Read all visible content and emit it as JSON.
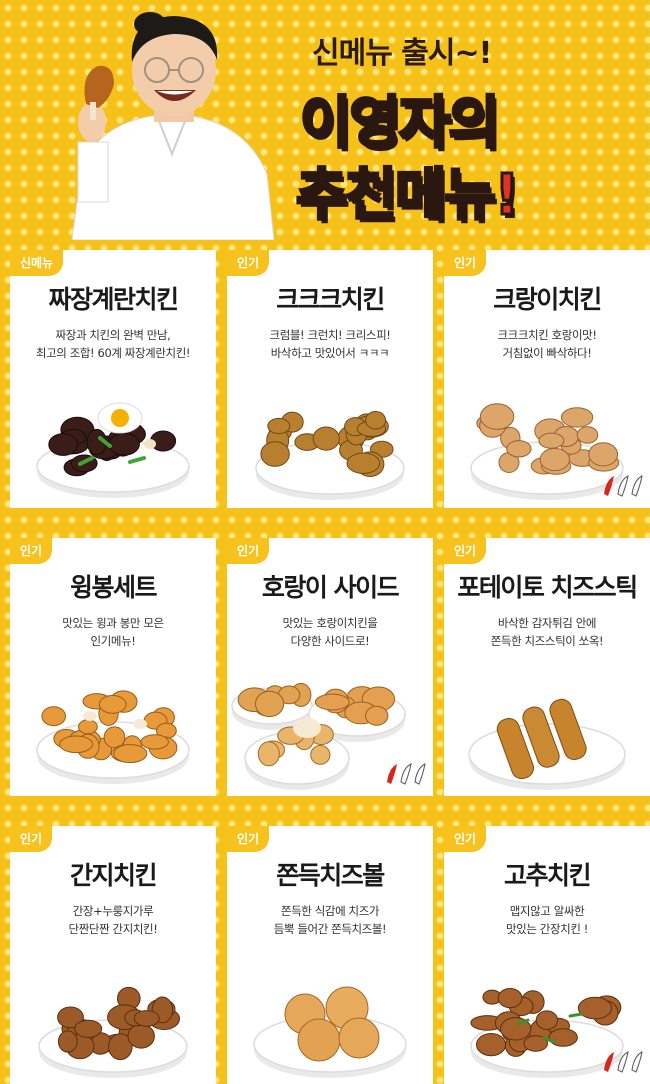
{
  "header": {
    "subtitle": "신메뉴 출시~!",
    "title_line1": "이영자의",
    "title_line2": "추천메뉴!"
  },
  "colors": {
    "background": "#f6c21a",
    "badge": "#f7c21e",
    "title_brown": "#3b2117",
    "title_red": "#e1322a",
    "pepper_red": "#d9261c"
  },
  "menu": [
    {
      "badge": "신메뉴",
      "name": "짜장계란치킨",
      "desc": "짜장과 치킨의 완벽 만남,\n최고의 조합! 60계 짜장계란치킨!",
      "spicy": 0,
      "food": "black-chicken-egg"
    },
    {
      "badge": "인기",
      "name": "크크크치킨",
      "desc": "크럼블! 크런치! 크리스피!\n바삭하고 맛있어서 ㅋㅋㅋ",
      "spicy": 0,
      "food": "crumble-chicken"
    },
    {
      "badge": "인기",
      "name": "크랑이치킨",
      "desc": "크크크치킨 호랑이맛!\n거침없이 빠삭하다!",
      "spicy": 1,
      "food": "spicy-crispy-chicken"
    },
    {
      "badge": "인기",
      "name": "윙봉세트",
      "desc": "맛있는 윙과 봉만 모은\n인기메뉴!",
      "spicy": 0,
      "food": "wing-set"
    },
    {
      "badge": "인기",
      "name": "호랑이 사이드",
      "desc": "맛있는 호랑이치킨을\n다양한 사이드로!",
      "spicy": 1,
      "food": "side-plates"
    },
    {
      "badge": "인기",
      "name": "포테이토 치즈스틱",
      "desc": "바삭한 감자튀김 안에\n쫀득한 치즈스틱이 쏘옥!",
      "spicy": 0,
      "food": "cheese-sticks"
    },
    {
      "badge": "인기",
      "name": "간지치킨",
      "desc": "간장+누룽지가루\n단짠단짠 간지치킨!",
      "spicy": 0,
      "food": "soy-chicken"
    },
    {
      "badge": "인기",
      "name": "쫀득치즈볼",
      "desc": "쫀득한 식감에 치즈가\n듬뿍 들어간 쫀득치즈볼!",
      "spicy": 0,
      "food": "cheese-balls"
    },
    {
      "badge": "인기",
      "name": "고추치킨",
      "desc": "맵지않고 알싸한\n맛있는 간장치킨 !",
      "spicy": 1,
      "food": "pepper-chicken"
    }
  ]
}
